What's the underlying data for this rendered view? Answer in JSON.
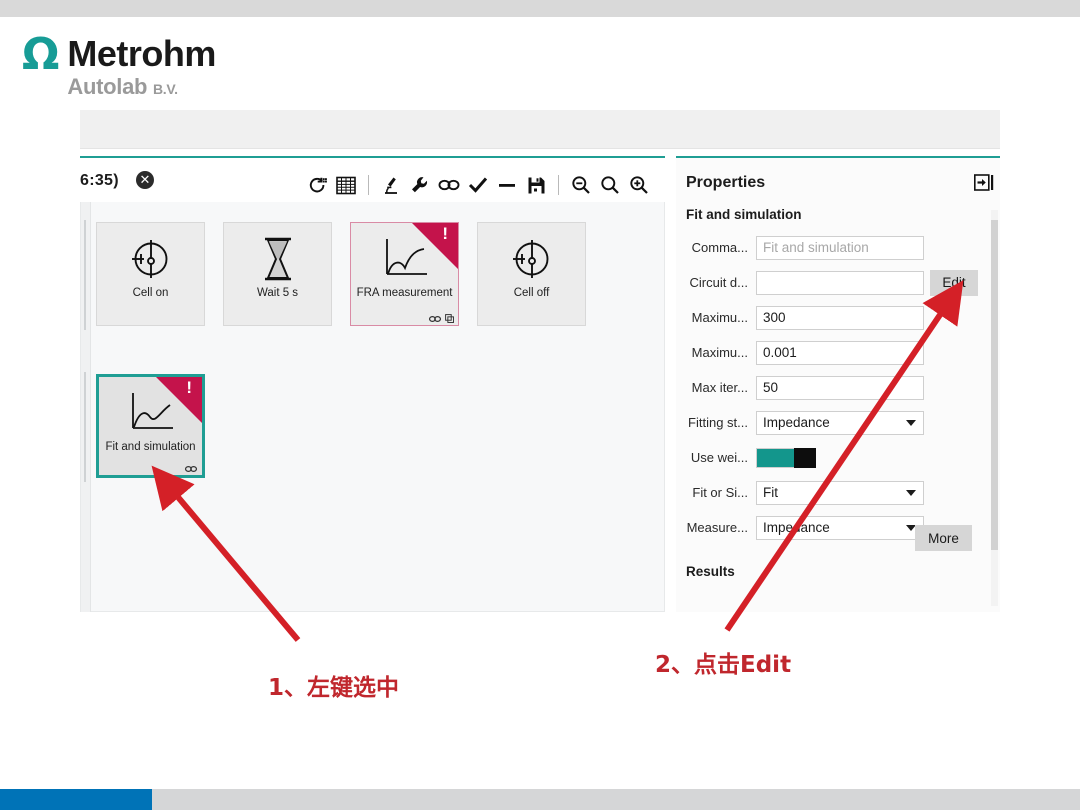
{
  "slide": {
    "logo": {
      "omega": "Ω",
      "brand": "Metrohm",
      "product": "Autolab",
      "suffix": "B.V."
    },
    "top_band_color": "#d9d9d9",
    "bottom_band_color": "#d5d6d7",
    "bottom_accent_color": "#0073b7"
  },
  "editor": {
    "tab_title": "6:35)",
    "tab_close_icon": "✕",
    "accent_color": "#1f9e94",
    "toolbar": [
      {
        "name": "refresh-loop-icon",
        "glyph": "↻"
      },
      {
        "name": "grid-table-icon",
        "glyph": "▦"
      },
      {
        "name": "separator",
        "glyph": ""
      },
      {
        "name": "microscope-icon",
        "glyph": "⚗"
      },
      {
        "name": "wrench-icon",
        "glyph": "🔧"
      },
      {
        "name": "link-chain-icon",
        "glyph": "⚭"
      },
      {
        "name": "checkmark-icon",
        "glyph": "✔"
      },
      {
        "name": "minus-icon",
        "glyph": "−"
      },
      {
        "name": "save-floppy-icon",
        "glyph": "💾"
      },
      {
        "name": "separator",
        "glyph": ""
      },
      {
        "name": "zoom-out-icon",
        "glyph": "⊖"
      },
      {
        "name": "zoom-reset-icon",
        "glyph": "○"
      },
      {
        "name": "zoom-in-icon",
        "glyph": "⊕"
      }
    ],
    "tiles_row1": [
      {
        "label": "Cell on",
        "icon": "cell-on-icon",
        "warning": false,
        "selected": false,
        "badges": []
      },
      {
        "label": "Wait 5 s",
        "icon": "hourglass-icon",
        "warning": false,
        "selected": false,
        "badges": []
      },
      {
        "label": "FRA measurement",
        "icon": "fra-plot-icon",
        "warning": true,
        "selected": false,
        "badges": [
          "link",
          "copy"
        ]
      },
      {
        "label": "Cell off",
        "icon": "cell-off-icon",
        "warning": false,
        "selected": false,
        "badges": []
      }
    ],
    "tiles_row2": [
      {
        "label": "Fit and simulation",
        "icon": "fit-curve-icon",
        "warning": true,
        "selected": true,
        "badges": [
          "link"
        ]
      }
    ],
    "warning_badge": "!"
  },
  "properties": {
    "title": "Properties",
    "dock_icon": "dock-right-icon",
    "subtitle": "Fit and simulation",
    "fields": [
      {
        "label": "Comma...",
        "type": "text",
        "value": "",
        "placeholder": "Fit and simulation",
        "button": null
      },
      {
        "label": "Circuit d...",
        "type": "text",
        "value": "",
        "placeholder": "",
        "button": "Edit"
      },
      {
        "label": "Maximu...",
        "type": "text",
        "value": "300",
        "placeholder": "",
        "button": null
      },
      {
        "label": "Maximu...",
        "type": "text",
        "value": "0.001",
        "placeholder": "",
        "button": null
      },
      {
        "label": "Max iter...",
        "type": "text",
        "value": "50",
        "placeholder": "",
        "button": null
      },
      {
        "label": "Fitting st...",
        "type": "select",
        "value": "Impedance",
        "placeholder": "",
        "button": null
      },
      {
        "label": "Use wei...",
        "type": "toggle",
        "value": "on",
        "placeholder": "",
        "button": null
      },
      {
        "label": "Fit or Si...",
        "type": "select",
        "value": "Fit",
        "placeholder": "",
        "button": null
      },
      {
        "label": "Measure...",
        "type": "select",
        "value": "Impedance",
        "placeholder": "",
        "button": null
      }
    ],
    "more_label": "More",
    "results_label": "Results",
    "toggle_on_color": "#13968c"
  },
  "annotations": {
    "color": "#c0272d",
    "step1": "1、左键选中",
    "step2": "2、点击Edit"
  }
}
